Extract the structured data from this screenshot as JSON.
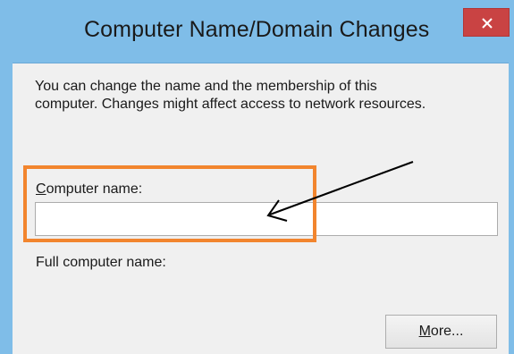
{
  "window": {
    "title": "Computer Name/Domain Changes",
    "close_glyph": "✕",
    "titlebar_color": "#7fbde8",
    "close_color": "#c94343"
  },
  "description": {
    "line1": "You can change the name and the membership of this",
    "line2": "computer. Changes might affect access to network resources."
  },
  "computer_name": {
    "label_mnemonic": "C",
    "label_rest": "omputer name:",
    "value": "",
    "placeholder": ""
  },
  "full_computer_name": {
    "label": "Full computer name:"
  },
  "more_button": {
    "label_mnemonic": "M",
    "label_rest": "ore..."
  },
  "annotation": {
    "highlight_color": "#f2852e",
    "arrow_color": "#000000",
    "arrow_icon": "arrow-pointer-icon"
  }
}
